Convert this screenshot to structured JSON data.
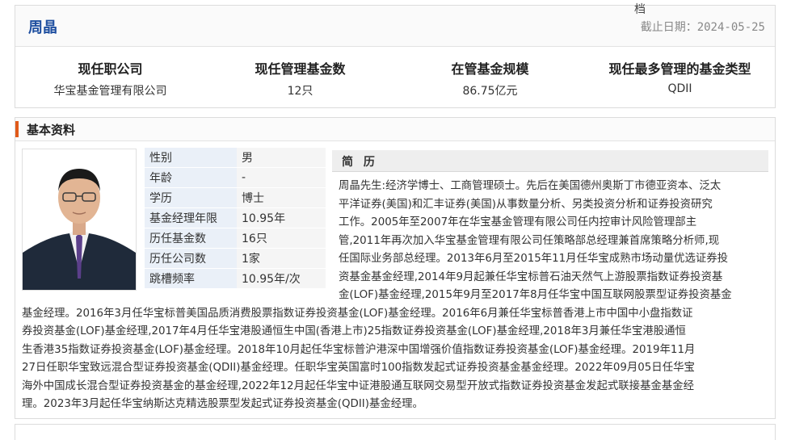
{
  "header": {
    "manager_name": "周晶",
    "archive_glyph": "档",
    "as_of_label": "截止日期：",
    "as_of_date": "2024-05-25"
  },
  "stats": [
    {
      "label": "现任职公司",
      "value": "华宝基金管理有限公司"
    },
    {
      "label": "现任管理基金数",
      "value": "12只"
    },
    {
      "label": "在管基金规模",
      "value": "86.75亿元"
    },
    {
      "label": "现任最多管理的基金类型",
      "value": "QDII"
    }
  ],
  "basic_info": {
    "section_title": "基本资料",
    "photo_icon": "manager-portrait",
    "rows": [
      {
        "key": "性别",
        "value": "男"
      },
      {
        "key": "年龄",
        "value": "-"
      },
      {
        "key": "学历",
        "value": "博士"
      },
      {
        "key": "基金经理年限",
        "value": "10.95年"
      },
      {
        "key": "历任基金数",
        "value": "16只"
      },
      {
        "key": "历任公司数",
        "value": "1家"
      },
      {
        "key": "跳槽频率",
        "value": "10.95年/次"
      }
    ],
    "resume_title": "简 历",
    "resume_lines": [
      "周晶先生:经济学博士、工商管理硕士。先后在美国德州奥斯丁市德亚资本、泛太",
      "平洋证券(美国)和汇丰证券(美国)从事数量分析、另类投资分析和证券投资研究",
      "工作。2005年至2007年在华宝基金管理有限公司任内控审计风险管理部主",
      "管,2011年再次加入华宝基金管理有限公司任策略部总经理兼首席策略分析师,现",
      "任国际业务部总经理。2013年6月至2015年11月任华宝成熟市场动量优选证券投",
      "资基金基金经理,2014年9月起兼任华宝标普石油天然气上游股票指数证券投资基",
      "金(LOF)基金经理,2015年9月至2017年8月任华宝中国互联网股票型证券投资基金",
      "基金经理。2016年3月任华宝标普美国品质消费股票指数证券投资基金(LOF)基金经理。2016年6月兼任华宝标普香港上市中国中小盘指数证",
      "券投资基金(LOF)基金经理,2017年4月任华宝港股通恒生中国(香港上市)25指数证券投资基金(LOF)基金经理,2018年3月兼任华宝港股通恒",
      "生香港35指数证券投资基金(LOF)基金经理。2018年10月起任华宝标普沪港深中国增强价值指数证券投资基金(LOF)基金经理。2019年11月",
      "27日任职华宝致远混合型证券投资基金(QDII)基金经理。任职华宝英国富时100指数发起式证券投资基金基金经理。2022年09月05日任华宝",
      "海外中国成长混合型证券投资基金的基金经理,2022年12月起任华宝中证港股通互联网交易型开放式指数证券投资基金发起式联接基金基金经",
      "理。2023年3月起任华宝纳斯达克精选股票型发起式证券投资基金(QDII)基金经理。"
    ]
  }
}
